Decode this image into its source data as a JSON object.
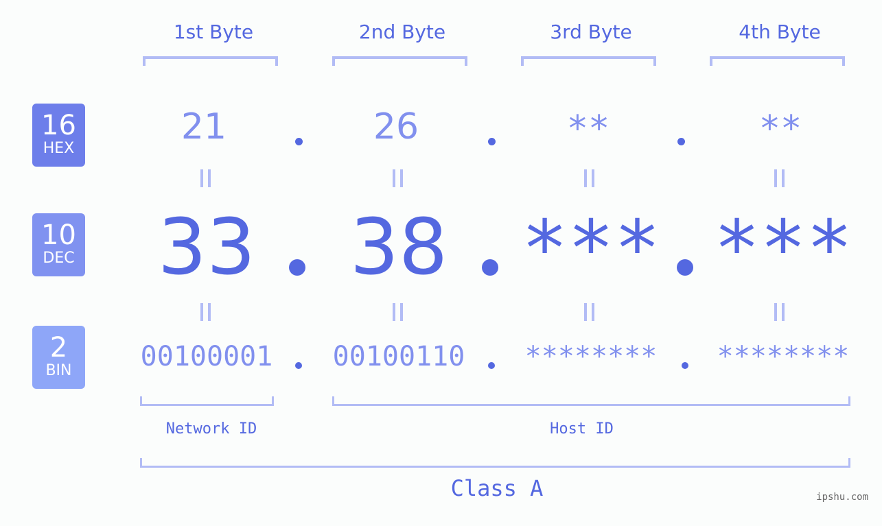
{
  "bytes": [
    {
      "label": "1st Byte",
      "hex": "21",
      "dec": "33",
      "bin": "00100001"
    },
    {
      "label": "2nd Byte",
      "hex": "26",
      "dec": "38",
      "bin": "00100110"
    },
    {
      "label": "3rd Byte",
      "hex": "**",
      "dec": "***",
      "bin": "********"
    },
    {
      "label": "4th Byte",
      "hex": "**",
      "dec": "***",
      "bin": "********"
    }
  ],
  "badges": {
    "hex": {
      "base": "16",
      "name": "HEX",
      "color": "#6d7eea"
    },
    "dec": {
      "base": "10",
      "name": "DEC",
      "color": "#8092f0"
    },
    "bin": {
      "base": "2",
      "name": "BIN",
      "color": "#8ea6f8"
    }
  },
  "segments": {
    "network": "Network ID",
    "host": "Host ID"
  },
  "ip_class": "Class A",
  "watermark": "ipshu.com",
  "colors": {
    "primary": "#5468e0",
    "secondary": "#8190ee",
    "bracket": "#b2bcf5",
    "background": "#fbfdfc"
  }
}
